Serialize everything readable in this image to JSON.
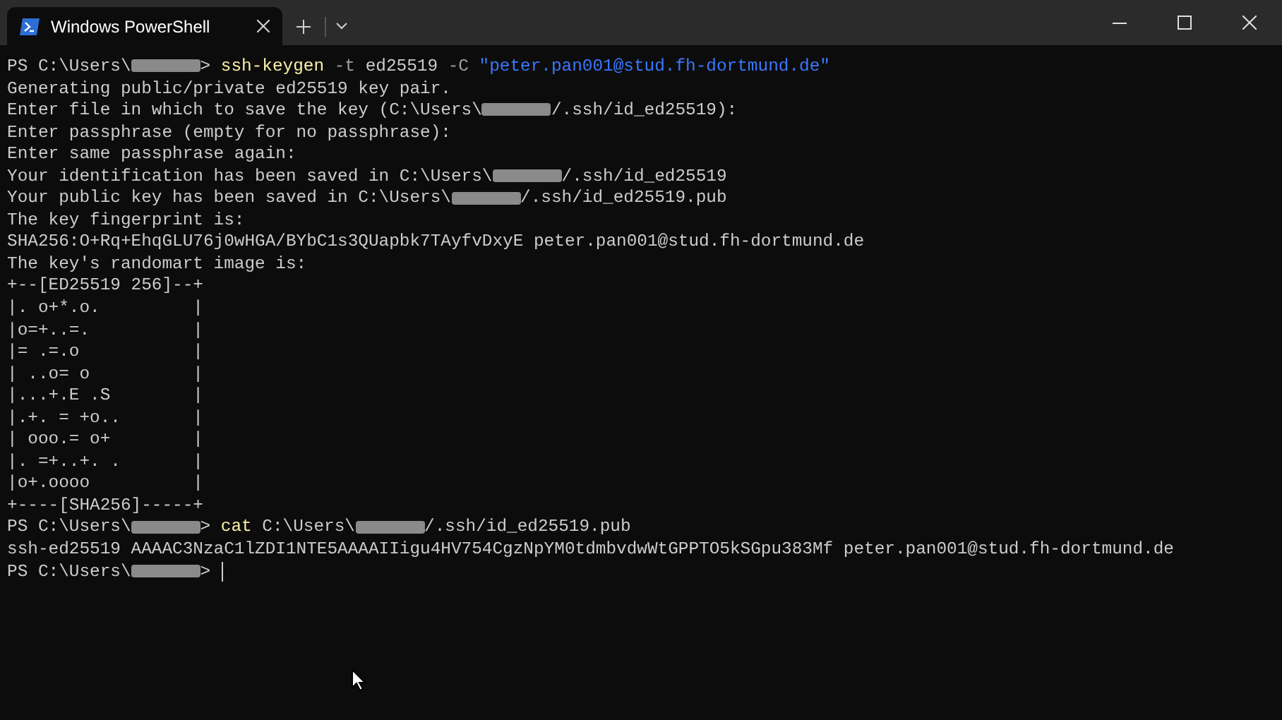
{
  "window": {
    "title": "Windows PowerShell",
    "tab_selected": true
  },
  "terminal": {
    "lines": [
      [
        {
          "kind": "text",
          "text": "PS C:\\Users\\"
        },
        {
          "kind": "redacted"
        },
        {
          "kind": "text",
          "text": "> "
        },
        {
          "kind": "command",
          "text": "ssh-keygen "
        },
        {
          "kind": "flag",
          "text": "-t"
        },
        {
          "kind": "text",
          "text": " ed25519 "
        },
        {
          "kind": "flag",
          "text": "-C "
        },
        {
          "kind": "string",
          "text": "\"peter.pan001@stud.fh-dortmund.de\""
        }
      ],
      [
        {
          "kind": "text",
          "text": "Generating public/private ed25519 key pair."
        }
      ],
      [
        {
          "kind": "text",
          "text": "Enter file in which to save the key (C:\\Users\\"
        },
        {
          "kind": "redacted"
        },
        {
          "kind": "text",
          "text": "/.ssh/id_ed25519):"
        }
      ],
      [
        {
          "kind": "text",
          "text": "Enter passphrase (empty for no passphrase):"
        }
      ],
      [
        {
          "kind": "text",
          "text": "Enter same passphrase again:"
        }
      ],
      [
        {
          "kind": "text",
          "text": "Your identification has been saved in C:\\Users\\"
        },
        {
          "kind": "redacted"
        },
        {
          "kind": "text",
          "text": "/.ssh/id_ed25519"
        }
      ],
      [
        {
          "kind": "text",
          "text": "Your public key has been saved in C:\\Users\\"
        },
        {
          "kind": "redacted"
        },
        {
          "kind": "text",
          "text": "/.ssh/id_ed25519.pub"
        }
      ],
      [
        {
          "kind": "text",
          "text": "The key fingerprint is:"
        }
      ],
      [
        {
          "kind": "text",
          "text": "SHA256:O+Rq+EhqGLU76j0wHGA/BYbC1s3QUapbk7TAyfvDxyE peter.pan001@stud.fh-dortmund.de"
        }
      ],
      [
        {
          "kind": "text",
          "text": "The key's randomart image is:"
        }
      ],
      [
        {
          "kind": "text",
          "text": "+--[ED25519 256]--+"
        }
      ],
      [
        {
          "kind": "text",
          "text": "|. o+*.o.         |"
        }
      ],
      [
        {
          "kind": "text",
          "text": "|o=+..=.          |"
        }
      ],
      [
        {
          "kind": "text",
          "text": "|= .=.o           |"
        }
      ],
      [
        {
          "kind": "text",
          "text": "| ..o= o          |"
        }
      ],
      [
        {
          "kind": "text",
          "text": "|...+.E .S        |"
        }
      ],
      [
        {
          "kind": "text",
          "text": "|.+. = +o..       |"
        }
      ],
      [
        {
          "kind": "text",
          "text": "| ooo.= o+        |"
        }
      ],
      [
        {
          "kind": "text",
          "text": "|. =+..+. .       |"
        }
      ],
      [
        {
          "kind": "text",
          "text": "|o+.oooo          |"
        }
      ],
      [
        {
          "kind": "text",
          "text": "+----[SHA256]-----+"
        }
      ],
      [
        {
          "kind": "text",
          "text": "PS C:\\Users\\"
        },
        {
          "kind": "redacted"
        },
        {
          "kind": "text",
          "text": "> "
        },
        {
          "kind": "command",
          "text": "cat"
        },
        {
          "kind": "text",
          "text": " C:\\Users\\"
        },
        {
          "kind": "redacted"
        },
        {
          "kind": "text",
          "text": "/.ssh/id_ed25519.pub"
        }
      ],
      [
        {
          "kind": "text",
          "text": "ssh-ed25519 AAAAC3NzaC1lZDI1NTE5AAAAIIigu4HV754CgzNpYM0tdmbvdwWtGPPTO5kSGpu383Mf peter.pan001@stud.fh-dortmund.de"
        }
      ],
      [
        {
          "kind": "text",
          "text": "PS C:\\Users\\"
        },
        {
          "kind": "redacted"
        },
        {
          "kind": "text",
          "text": "> "
        },
        {
          "kind": "cursor"
        }
      ]
    ]
  }
}
